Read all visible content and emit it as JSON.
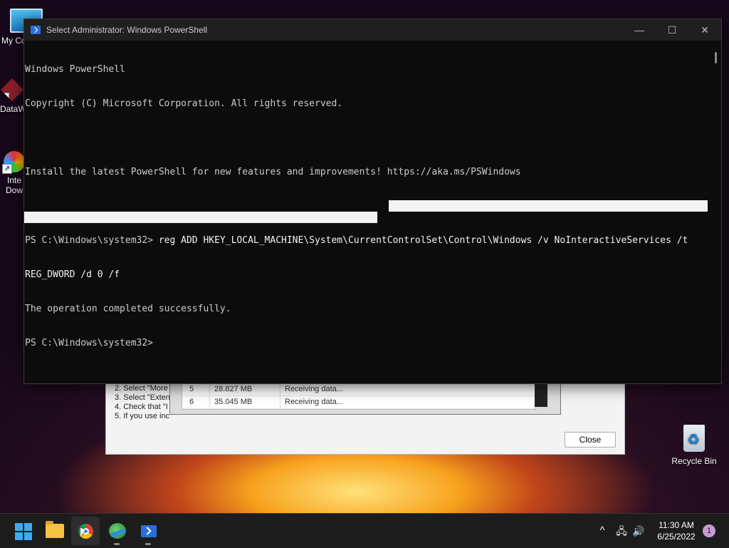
{
  "desktop": {
    "icons": [
      {
        "label": "My Co"
      },
      {
        "label": "DataW"
      },
      {
        "label": "Inte"
      },
      {
        "label": "Dow"
      }
    ],
    "recycle_bin": "Recycle Bin"
  },
  "background_dialog": {
    "steps": [
      "2. Select \"More",
      "3. Select \"Exten",
      "4. Check that \"I",
      "5. If you use inc"
    ],
    "close_label": "Close",
    "downloads": [
      {
        "num": "5",
        "size": "28.827 MB",
        "status": "Receiving data..."
      },
      {
        "num": "6",
        "size": "35.045 MB",
        "status": "Receiving data..."
      }
    ]
  },
  "powershell": {
    "title": "Select Administrator: Windows PowerShell",
    "controls": {
      "minimize": "—",
      "maximize": "☐",
      "close": "✕"
    },
    "lines": [
      "Windows PowerShell",
      "Copyright (C) Microsoft Corporation. All rights reserved.",
      "",
      "Install the latest PowerShell for new features and improvements! https://aka.ms/PSWindows",
      ""
    ],
    "command_prompt": "PS C:\\Windows\\system32> ",
    "command": "reg ADD HKEY_LOCAL_MACHINE\\System\\CurrentControlSet\\Control\\Windows /v NoInteractiveServices /t",
    "command_wrap": "REG_DWORD /d 0 /f",
    "result": "The operation completed successfully.",
    "final_prompt": "PS C:\\Windows\\system32>"
  },
  "taskbar": {
    "tray": {
      "chevron": "^",
      "network": "🖧",
      "volume": "🔊"
    },
    "time": "11:30 AM",
    "date": "6/25/2022",
    "notification_count": "1"
  }
}
